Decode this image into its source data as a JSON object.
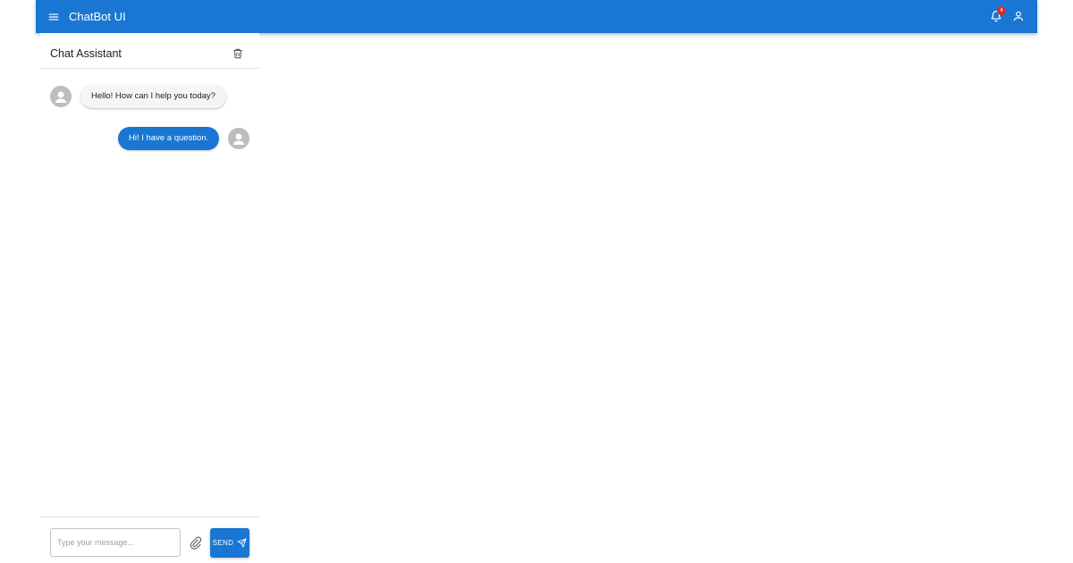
{
  "appbar": {
    "title": "ChatBot UI",
    "notification_count": "4",
    "icons": {
      "menu": "menu-icon",
      "notifications": "bell-icon",
      "account": "user-icon"
    },
    "color": "#1976d2"
  },
  "panel": {
    "title": "Chat Assistant",
    "delete_icon": "trash-icon"
  },
  "messages": [
    {
      "sender": "bot",
      "text": "Hello! How can I help you today?"
    },
    {
      "sender": "user",
      "text": "Hi! I have a question."
    }
  ],
  "composer": {
    "placeholder": "Type your message...",
    "value": "",
    "attach_icon": "paperclip-icon",
    "send_label": "SEND",
    "send_icon": "send-icon"
  },
  "colors": {
    "primary": "#1976d2",
    "badge": "#d32f2f",
    "bot_bubble": "#f5f5f5",
    "avatar": "#bdbdbd"
  }
}
